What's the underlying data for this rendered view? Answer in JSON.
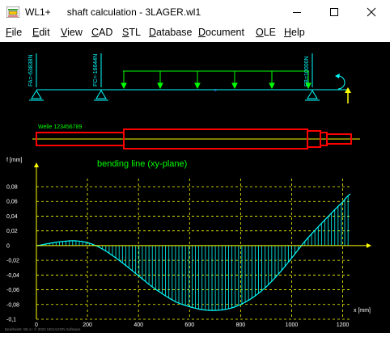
{
  "window": {
    "app_name": "WL1+",
    "subtitle": "shaft calculation",
    "document": "3LAGER.wl1"
  },
  "menu": [
    {
      "label": "File",
      "mnemonic": "F"
    },
    {
      "label": "Edit",
      "mnemonic": "E"
    },
    {
      "label": "View",
      "mnemonic": "V"
    },
    {
      "label": "CAD",
      "mnemonic": "C"
    },
    {
      "label": "STL",
      "mnemonic": "S"
    },
    {
      "label": "Database",
      "mnemonic": "D"
    },
    {
      "label": "Document",
      "mnemonic": "D"
    },
    {
      "label": "OLE",
      "mnemonic": "O"
    },
    {
      "label": "Help",
      "mnemonic": "H"
    }
  ],
  "shaft_model": {
    "support_labels": [
      "FA=-63838N",
      "FC=-16644N",
      "FB=10000N"
    ],
    "shaft_name": "Welle 123456789"
  },
  "chart_data": {
    "type": "area",
    "title": "bending line (xy-plane)",
    "xlabel": "x [mm]",
    "ylabel": "f [mm]",
    "xlim": [
      0,
      1230
    ],
    "ylim": [
      -0.1,
      0.08
    ],
    "x_ticks": [
      0,
      200,
      400,
      600,
      800,
      1000,
      1200
    ],
    "y_ticks": [
      0.08,
      0.06,
      0.04,
      0.02,
      0,
      -0.02,
      -0.04,
      -0.06,
      -0.08,
      -0.1
    ],
    "y_tick_labels": [
      "0,08",
      "0,06",
      "0,04",
      "0,02",
      "0",
      "-0,02",
      "-0,04",
      "-0,06",
      "-0,08",
      "-0,1"
    ],
    "grid": true,
    "colors": {
      "curve": "#00ffff",
      "grid": "#ffff00",
      "title": "#00ff00"
    },
    "x": [
      0,
      50,
      100,
      150,
      200,
      250,
      300,
      350,
      400,
      450,
      500,
      550,
      600,
      650,
      700,
      750,
      800,
      850,
      900,
      950,
      1000,
      1050,
      1100,
      1150,
      1200,
      1230
    ],
    "y": [
      0,
      0.003,
      0.0055,
      0.0065,
      0.004,
      -0.003,
      -0.014,
      -0.027,
      -0.041,
      -0.055,
      -0.067,
      -0.077,
      -0.083,
      -0.087,
      -0.088,
      -0.086,
      -0.08,
      -0.07,
      -0.056,
      -0.038,
      -0.017,
      0.005,
      0.024,
      0.042,
      0.059,
      0.07
    ]
  },
  "footer_text": "Bearbeitet: WL1+ © 2022 HEXAGON Software"
}
